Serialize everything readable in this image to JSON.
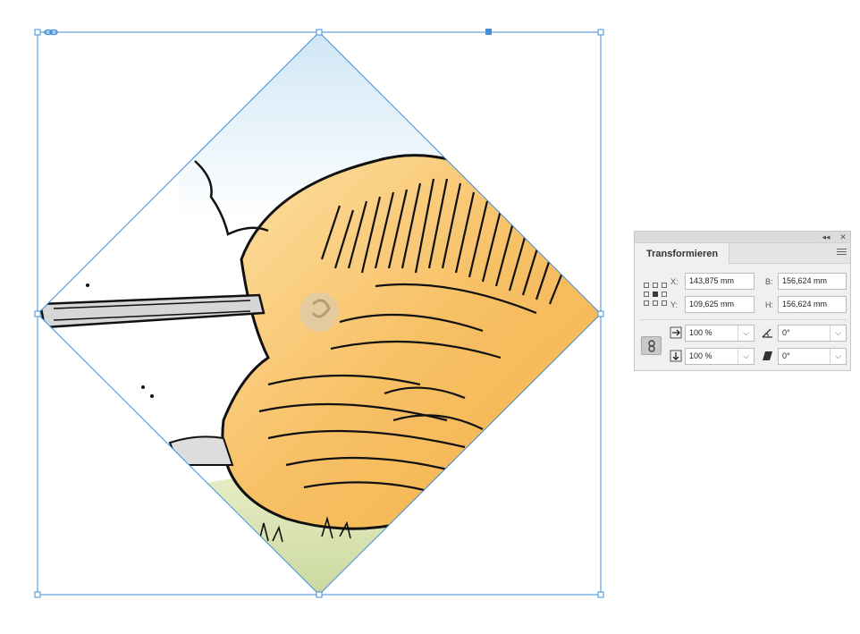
{
  "panel": {
    "title": "Transformieren",
    "titlebar_icons": [
      "collapse-panel-icon",
      "close-panel-icon"
    ],
    "titlebar_collapse_glyph": "◂◂",
    "titlebar_close_glyph": "✕",
    "menu_icon": "panel-menu-icon",
    "reference_point": "center",
    "fields": {
      "x_label": "X:",
      "x_value": "143,875 mm",
      "y_label": "Y:",
      "y_value": "109,625 mm",
      "w_label": "B:",
      "w_value": "156,624 mm",
      "h_label": "H:",
      "h_value": "156,624 mm"
    },
    "scale": {
      "x_value": "100 %",
      "y_value": "100 %",
      "x_icon": "scale-x-icon",
      "y_icon": "scale-y-icon",
      "constrain_icon": "constrain-link-icon"
    },
    "rotate": {
      "angle_value": "0°",
      "shear_value": "0°",
      "angle_icon": "rotate-angle-icon",
      "shear_icon": "shear-angle-icon"
    },
    "dropdown_glyph": "⌵"
  },
  "canvas": {
    "selection_color": "#3f8fdb",
    "selected_object": "rotated-illustration-square",
    "illustration": {
      "sky_color": "#cfe6f5",
      "stone_color": "#f7c065",
      "grass_color": "#c8d79a",
      "ink_color": "#111111"
    }
  }
}
